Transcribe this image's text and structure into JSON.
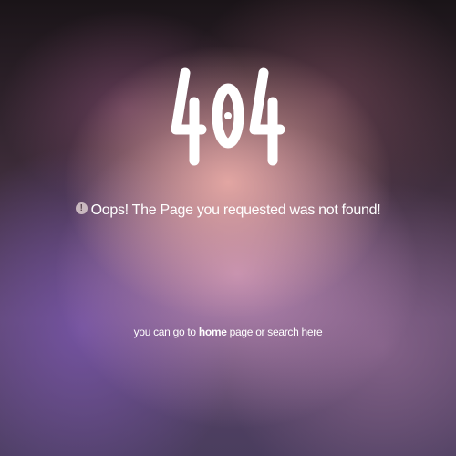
{
  "error": {
    "code": "404",
    "message": "Oops! The Page you requested was not found!",
    "icon": "info-icon"
  },
  "hint": {
    "prefix": "you can go to ",
    "home_link": "home",
    "suffix": " page or search here"
  },
  "colors": {
    "text": "#ffffff",
    "glow": "#e8aaa5",
    "accent_purple": "#7855aa"
  }
}
